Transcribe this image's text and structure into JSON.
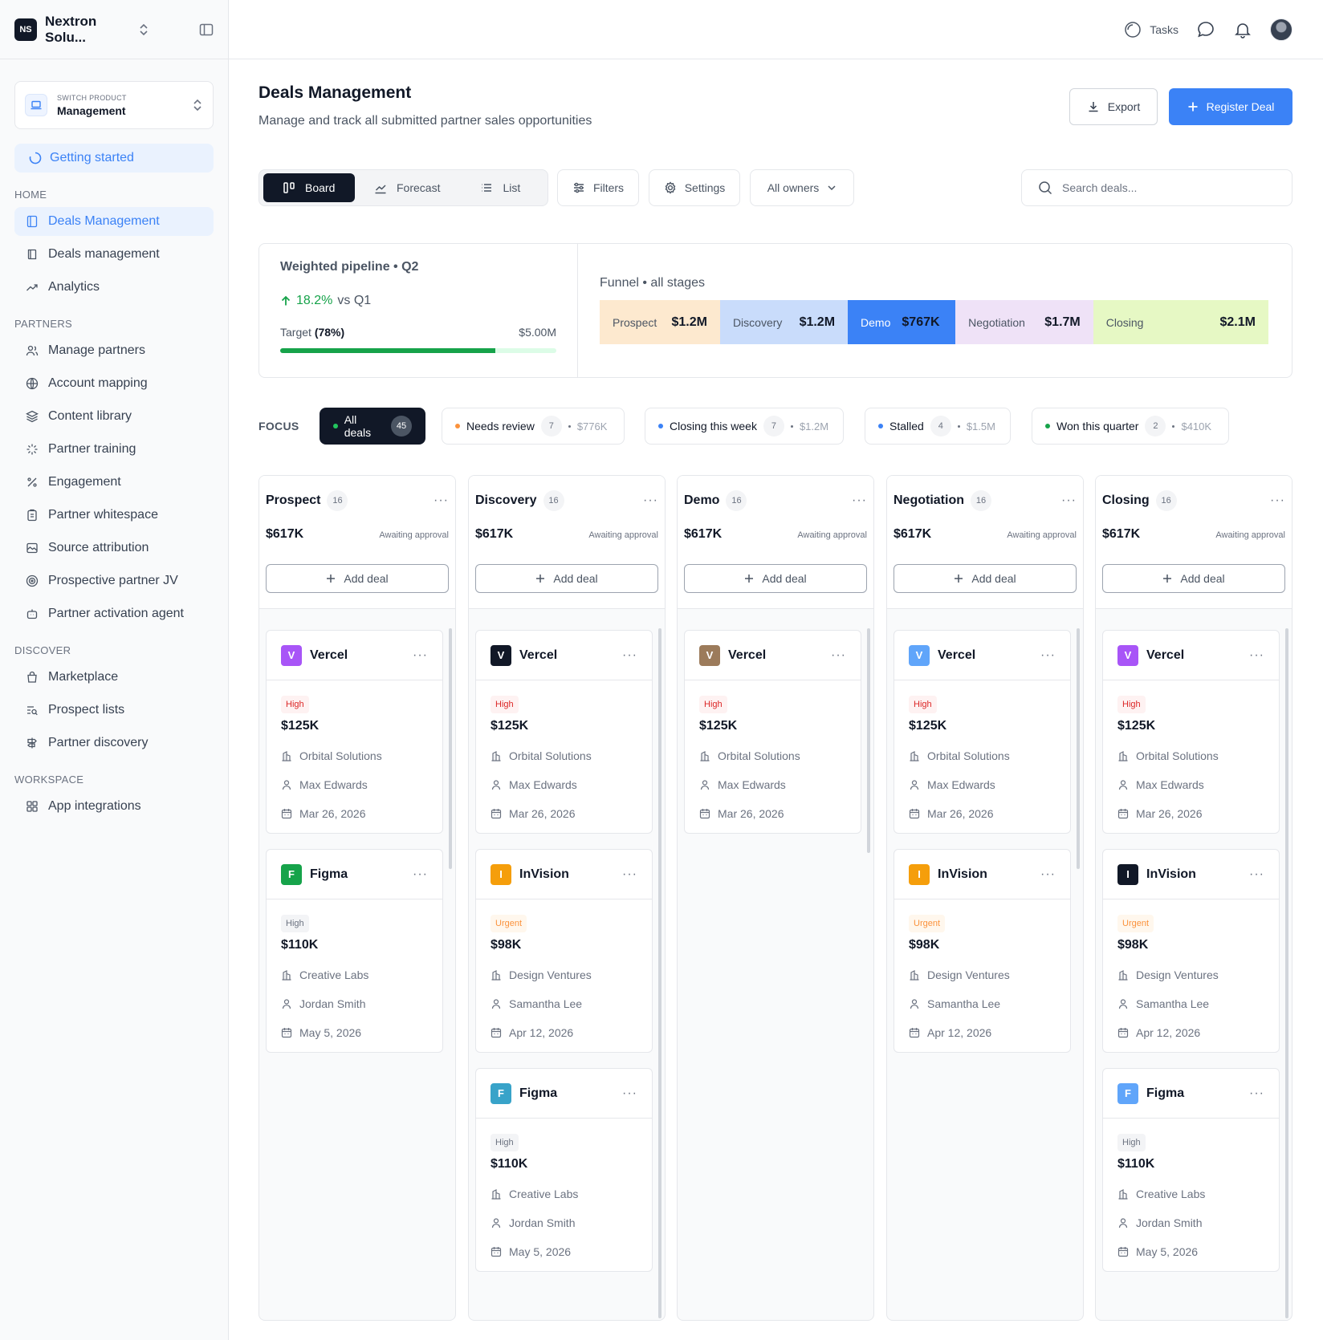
{
  "app": {
    "org_initials": "NS",
    "org_name": "Nextron Solu...",
    "switch_label": "SWITCH PRODUCT",
    "product": "Management",
    "getting_started": "Getting started"
  },
  "sidebar": {
    "sections": [
      {
        "label": "HOME",
        "items": [
          {
            "label": "Deals Management",
            "icon": "layout-icon",
            "active": true
          },
          {
            "label": "Deals management",
            "icon": "book-icon"
          },
          {
            "label": "Analytics",
            "icon": "trending-up-icon"
          }
        ]
      },
      {
        "label": "PARTNERS",
        "items": [
          {
            "label": "Manage partners",
            "icon": "users-icon"
          },
          {
            "label": "Account mapping",
            "icon": "globe-icon"
          },
          {
            "label": "Content library",
            "icon": "layers-icon"
          },
          {
            "label": "Partner training",
            "icon": "sparkle-icon"
          },
          {
            "label": "Engagement",
            "icon": "percent-icon"
          },
          {
            "label": "Partner whitespace",
            "icon": "clipboard-icon"
          },
          {
            "label": "Source attribution",
            "icon": "image-icon"
          },
          {
            "label": "Prospective partner JV",
            "icon": "target-icon"
          },
          {
            "label": "Partner activation agent",
            "icon": "bot-icon"
          }
        ]
      },
      {
        "label": "DISCOVER",
        "items": [
          {
            "label": "Marketplace",
            "icon": "bag-icon"
          },
          {
            "label": "Prospect lists",
            "icon": "list-search-icon"
          },
          {
            "label": "Partner discovery",
            "icon": "signpost-icon"
          }
        ]
      },
      {
        "label": "WORKSPACE",
        "items": [
          {
            "label": "App integrations",
            "icon": "grid-icon"
          }
        ]
      }
    ]
  },
  "topbar": {
    "tasks": "Tasks"
  },
  "page": {
    "title": "Deals Management",
    "subtitle": "Manage and track all submitted partner sales opportunities",
    "export": "Export",
    "register": "Register Deal"
  },
  "toolbar": {
    "views": [
      "Board",
      "Forecast",
      "List"
    ],
    "filters": "Filters",
    "settings": "Settings",
    "owners": "All owners",
    "search_placeholder": "Search deals..."
  },
  "stats": {
    "title": "Weighted pipeline",
    "period": "Q2",
    "growth": "18.2%",
    "growth_suffix": "vs Q1",
    "target_label": "Target",
    "target_pct": "(78%)",
    "target_fraction": 0.78,
    "target_value": "$5.00M",
    "funnel_title": "Funnel • all stages",
    "funnel": [
      {
        "label": "Prospect",
        "value": "$1.2M",
        "bg": "#fde9cf",
        "share": 0.18
      },
      {
        "label": "Discovery",
        "value": "$1.2M",
        "bg": "#c9dcfb",
        "share": 0.191
      },
      {
        "label": "Demo",
        "value": "$767K",
        "bg": "#3b82f6",
        "share": 0.161
      },
      {
        "label": "Negotiation",
        "value": "$1.7M",
        "bg": "#efe2f7",
        "share": 0.206
      },
      {
        "label": "Closing",
        "value": "$2.1M",
        "bg": "#e6f8c4",
        "share": 0.262
      }
    ]
  },
  "focus": {
    "label": "FOCUS",
    "chips": [
      {
        "label": "All deals",
        "count": "45",
        "amount": "",
        "dot": "#22c55e",
        "active": true
      },
      {
        "label": "Needs review",
        "count": "7",
        "amount": "$776K",
        "dot": "#fb923c"
      },
      {
        "label": "Closing this week",
        "count": "7",
        "amount": "$1.2M",
        "dot": "#3b82f6"
      },
      {
        "label": "Stalled",
        "count": "4",
        "amount": "$1.5M",
        "dot": "#3b82f6"
      },
      {
        "label": "Won this quarter",
        "count": "2",
        "amount": "$410K",
        "dot": "#16a34a"
      }
    ]
  },
  "board": {
    "add_deal": "Add deal",
    "columns": [
      {
        "title": "Prospect",
        "count": "16",
        "amount": "$617K",
        "sub": "Awaiting approval",
        "cards": [
          {
            "company": "Vercel",
            "initial": "V",
            "color": "#a855f7",
            "priority": "High",
            "ptype": "high",
            "value": "$125K",
            "org": "Orbital Solutions",
            "owner": "Max Edwards",
            "date": "Mar 26, 2026"
          },
          {
            "company": "Figma",
            "initial": "F",
            "color": "#16a34a",
            "priority": "High",
            "ptype": "plain",
            "value": "$110K",
            "org": "Creative Labs",
            "owner": "Jordan Smith",
            "date": "May 5, 2026"
          }
        ]
      },
      {
        "title": "Discovery",
        "count": "16",
        "amount": "$617K",
        "sub": "Awaiting approval",
        "cards": [
          {
            "company": "Vercel",
            "initial": "V",
            "color": "#111827",
            "priority": "High",
            "ptype": "high",
            "value": "$125K",
            "org": "Orbital Solutions",
            "owner": "Max Edwards",
            "date": "Mar 26, 2026"
          },
          {
            "company": "InVision",
            "initial": "I",
            "color": "#f59e0b",
            "priority": "Urgent",
            "ptype": "urgent",
            "value": "$98K",
            "org": "Design Ventures",
            "owner": "Samantha Lee",
            "date": "Apr 12, 2026"
          },
          {
            "company": "Figma",
            "initial": "F",
            "color": "#38a3c9",
            "priority": "High",
            "ptype": "plain",
            "value": "$110K",
            "org": "Creative Labs",
            "owner": "Jordan Smith",
            "date": "May 5, 2026"
          }
        ]
      },
      {
        "title": "Demo",
        "count": "16",
        "amount": "$617K",
        "sub": "Awaiting approval",
        "cards": [
          {
            "company": "Vercel",
            "initial": "V",
            "color": "#9c7b5b",
            "priority": "High",
            "ptype": "high",
            "value": "$125K",
            "org": "Orbital Solutions",
            "owner": "Max Edwards",
            "date": "Mar 26, 2026"
          }
        ]
      },
      {
        "title": "Negotiation",
        "count": "16",
        "amount": "$617K",
        "sub": "Awaiting approval",
        "cards": [
          {
            "company": "Vercel",
            "initial": "V",
            "color": "#60a5fa",
            "priority": "High",
            "ptype": "high",
            "value": "$125K",
            "org": "Orbital Solutions",
            "owner": "Max Edwards",
            "date": "Mar 26, 2026"
          },
          {
            "company": "InVision",
            "initial": "I",
            "color": "#f59e0b",
            "priority": "Urgent",
            "ptype": "urgent",
            "value": "$98K",
            "org": "Design Ventures",
            "owner": "Samantha Lee",
            "date": "Apr 12, 2026"
          }
        ]
      },
      {
        "title": "Closing",
        "count": "16",
        "amount": "$617K",
        "sub": "Awaiting approval",
        "cards": [
          {
            "company": "Vercel",
            "initial": "V",
            "color": "#a855f7",
            "priority": "High",
            "ptype": "high",
            "value": "$125K",
            "org": "Orbital Solutions",
            "owner": "Max Edwards",
            "date": "Mar 26, 2026"
          },
          {
            "company": "InVision",
            "initial": "I",
            "color": "#111827",
            "priority": "Urgent",
            "ptype": "urgent",
            "value": "$98K",
            "org": "Design Ventures",
            "owner": "Samantha Lee",
            "date": "Apr 12, 2026"
          },
          {
            "company": "Figma",
            "initial": "F",
            "color": "#60a5fa",
            "priority": "High",
            "ptype": "plain",
            "value": "$110K",
            "org": "Creative Labs",
            "owner": "Jordan Smith",
            "date": "May 5, 2026"
          }
        ]
      }
    ]
  }
}
